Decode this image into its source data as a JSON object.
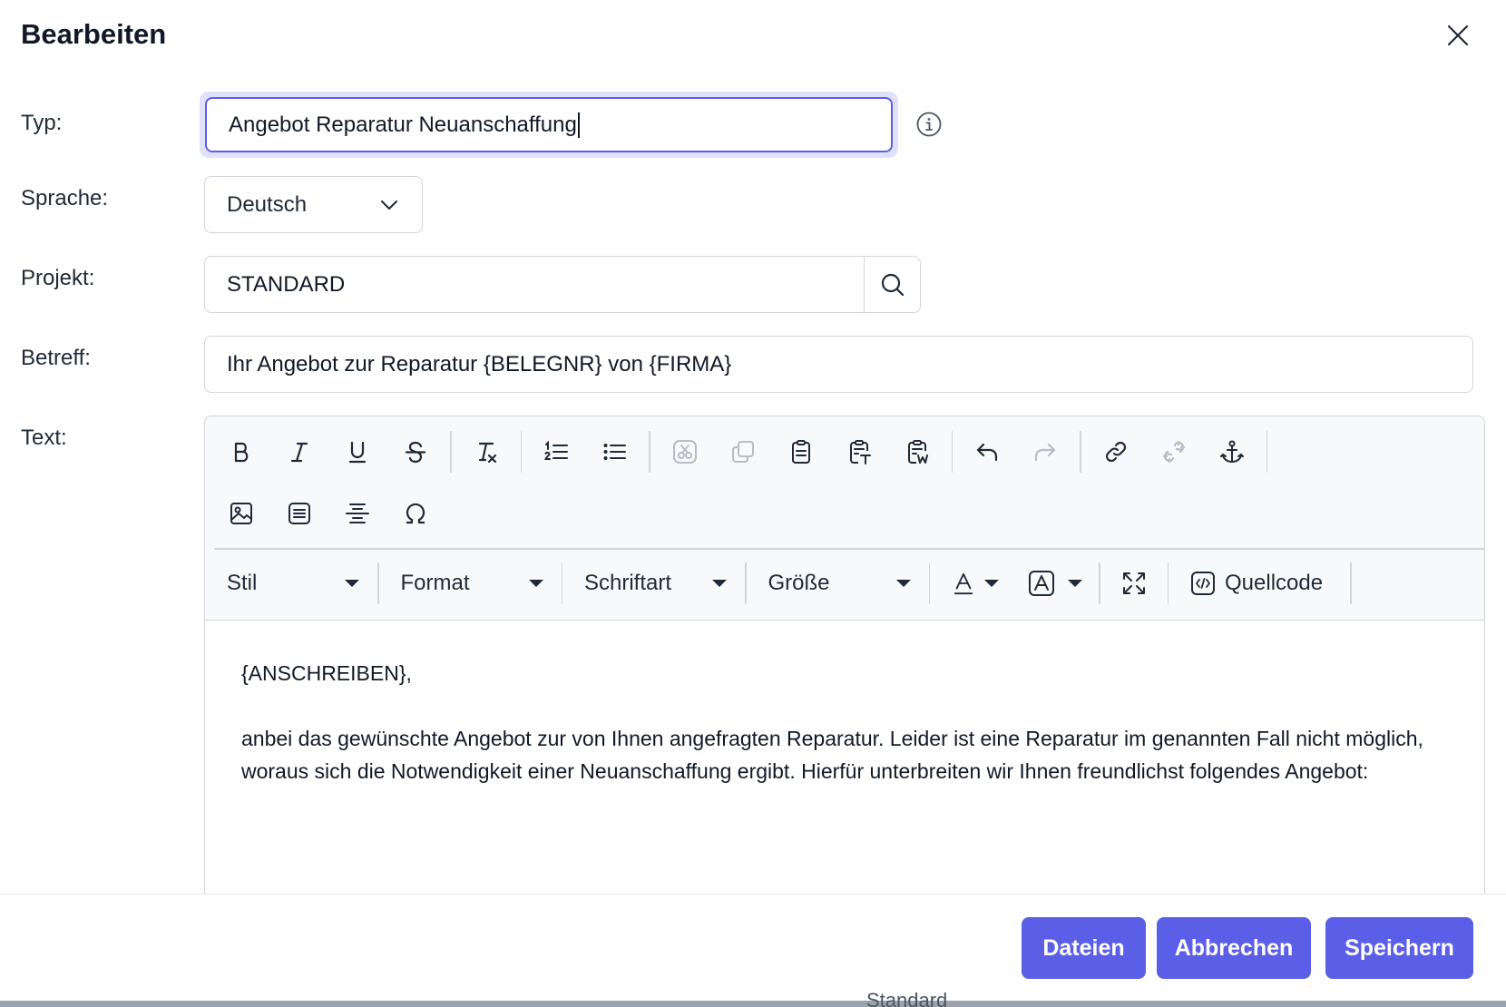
{
  "dialog": {
    "title": "Bearbeiten"
  },
  "form": {
    "typ_label": "Typ:",
    "typ_value": "Angebot Reparatur Neuanschaffung",
    "sprache_label": "Sprache:",
    "sprache_value": "Deutsch",
    "projekt_label": "Projekt:",
    "projekt_value": "STANDARD",
    "betreff_label": "Betreff:",
    "betreff_value": "Ihr Angebot zur Reparatur {BELEGNR} von {FIRMA}",
    "text_label": "Text:"
  },
  "toolbar": {
    "stil": "Stil",
    "format": "Format",
    "schriftart": "Schriftart",
    "groesse": "Größe",
    "quellcode": "Quellcode"
  },
  "editor": {
    "paragraph1": "{ANSCHREIBEN},",
    "paragraph2": "anbei das gewünschte Angebot zur von Ihnen angefragten Reparatur. Leider ist eine Reparatur im genannten Fall nicht möglich, woraus sich die Notwendigkeit einer Neuanschaffung ergibt. Hierfür unterbreiten wir Ihnen freundlichst folgendes Angebot:"
  },
  "footer": {
    "dateien": "Dateien",
    "abbrechen": "Abbrechen",
    "speichern": "Speichern"
  },
  "background": {
    "peek_text": "Standard"
  },
  "colors": {
    "accent": "#5b5fe8",
    "border": "#d1d5db",
    "toolbar_bg": "#f8f9fb"
  }
}
